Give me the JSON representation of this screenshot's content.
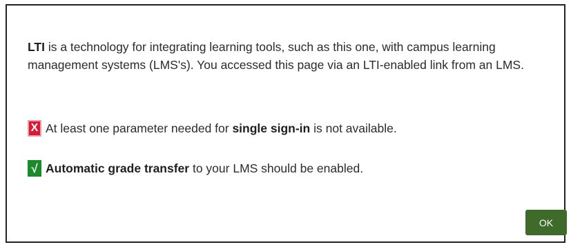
{
  "dialog": {
    "intro": {
      "lead_bold": "LTI",
      "rest": " is a technology for integrating learning tools, such as this one, with campus learning management systems (LMS's). You accessed this page via an LTI-enabled link from an LMS."
    },
    "single_sign_in": {
      "icon": "x-mark-icon",
      "icon_glyph": "X",
      "icon_color": "#d71b35",
      "text_before": "At least one parameter needed for ",
      "text_bold": "single sign-in",
      "text_after": " is not available."
    },
    "grade_transfer": {
      "icon": "check-mark-icon",
      "icon_glyph": "√",
      "icon_color": "#1a8a2a",
      "text_bold": "Automatic grade transfer",
      "text_after": " to your LMS should be enabled."
    },
    "ok_label": "OK",
    "ok_color": "#3f6b2a"
  }
}
